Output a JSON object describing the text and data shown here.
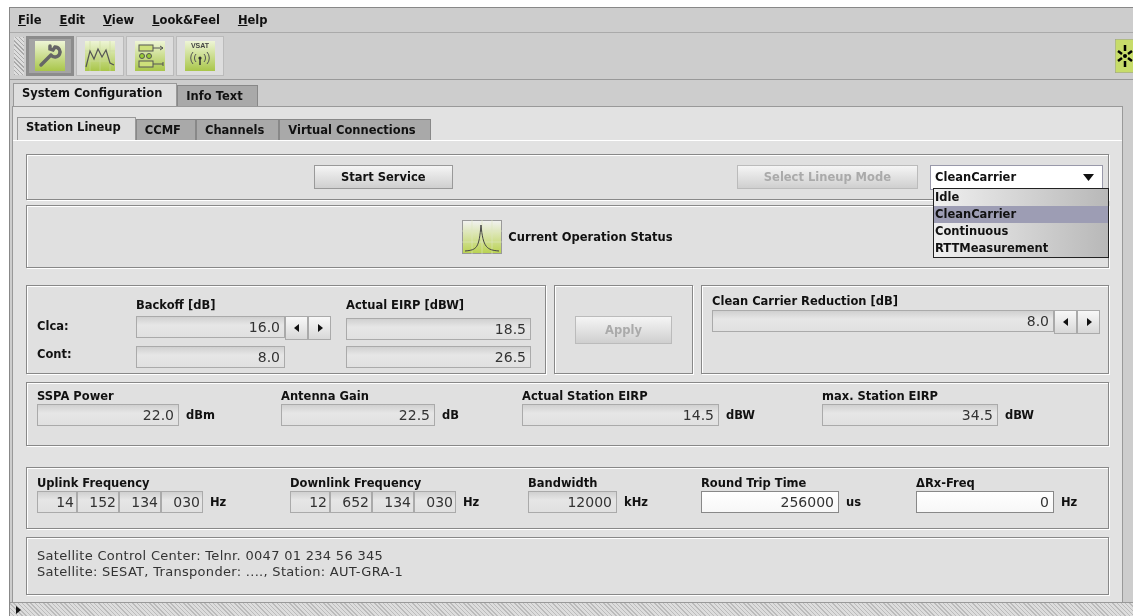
{
  "menu": [
    {
      "label": "File"
    },
    {
      "label": "Edit"
    },
    {
      "label": "View"
    },
    {
      "label": "Look&Feel"
    },
    {
      "label": "Help"
    }
  ],
  "toolbar": [
    {
      "kind": "wrench",
      "selected": true
    },
    {
      "kind": "chart",
      "selected": false
    },
    {
      "kind": "flow",
      "selected": false
    },
    {
      "kind": "vsat",
      "label": "VSAT",
      "selected": false
    }
  ],
  "outer_tabs": [
    {
      "label": "System Configuration",
      "selected": true
    },
    {
      "label": "Info Text",
      "selected": false
    }
  ],
  "inner_tabs": [
    {
      "label": "Station Lineup",
      "selected": true
    },
    {
      "label": "CCMF",
      "selected": false
    },
    {
      "label": "Channels",
      "selected": false
    },
    {
      "label": "Virtual Connections",
      "selected": false
    }
  ],
  "service": {
    "start_button": {
      "label": "Start Service",
      "disabled": false
    },
    "mode_button": {
      "label": "Select Lineup Mode",
      "disabled": true
    },
    "mode_combo": {
      "value": "CleanCarrier",
      "expanded": true,
      "options": [
        {
          "label": "Idle",
          "selected": false
        },
        {
          "label": "CleanCarrier",
          "selected": true
        },
        {
          "label": "Continuous",
          "selected": false
        },
        {
          "label": "RTTMeasurement",
          "selected": false
        }
      ]
    }
  },
  "status": {
    "label": "Current Operation Status"
  },
  "backoff": {
    "headers": [
      "Backoff [dB]",
      "Actual EIRP [dBW]"
    ],
    "rows": [
      {
        "label": "Clca:",
        "backoff": "16.0",
        "stepper": true,
        "eirp": "18.5"
      },
      {
        "label": "Cont:",
        "backoff": "8.0",
        "stepper": false,
        "eirp": "26.5"
      }
    ]
  },
  "apply_button": {
    "label": "Apply",
    "disabled": true
  },
  "reduction": {
    "label": "Clean Carrier Reduction [dB]",
    "value": "8.0"
  },
  "power": [
    {
      "label": "SSPA Power",
      "value": "22.0",
      "unit": "dBm"
    },
    {
      "label": "Antenna Gain",
      "value": "22.5",
      "unit": "dB"
    },
    {
      "label": "Actual Station EIRP",
      "value": "14.5",
      "unit": "dBW"
    },
    {
      "label": "max. Station EIRP",
      "value": "34.5",
      "unit": "dBW"
    }
  ],
  "frequency": [
    {
      "kind": "segmented",
      "label": "Uplink Frequency",
      "segments": [
        "14",
        "152",
        "134",
        "030"
      ],
      "unit": "Hz"
    },
    {
      "kind": "segmented",
      "label": "Downlink Frequency",
      "segments": [
        "12",
        "652",
        "134",
        "030"
      ],
      "unit": "Hz"
    },
    {
      "kind": "readonly",
      "label": "Bandwidth",
      "value": "12000",
      "unit": "kHz"
    },
    {
      "kind": "editable",
      "label": "Round Trip Time",
      "value": "256000",
      "unit": "us"
    },
    {
      "kind": "editable",
      "label": "ΔRx-Freq",
      "value": "0",
      "unit": "Hz"
    }
  ],
  "info": [
    "Satellite Control Center: Telnr. 0047 01 234 56 345",
    "Satellite: SESAT, Transponder: ...., Station: AUT-GRA-1"
  ]
}
